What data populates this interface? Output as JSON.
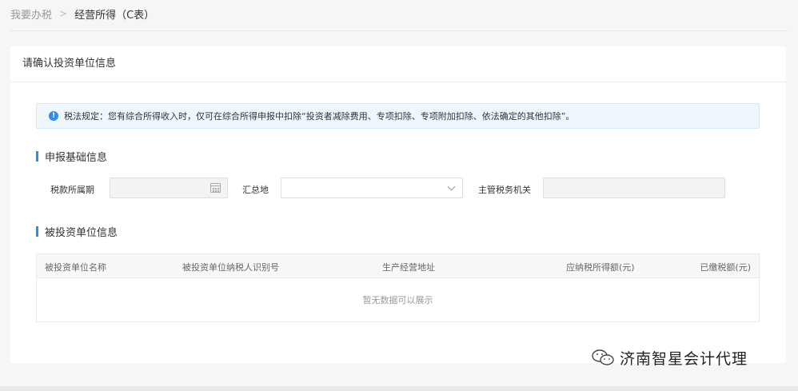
{
  "breadcrumb": {
    "home": "我要办税",
    "separator": ">",
    "current": "经营所得（C表）"
  },
  "card": {
    "title": "请确认投资单位信息"
  },
  "notice": {
    "icon": "info-icon",
    "text": "税法规定：您有综合所得收入时，仅可在综合所得申报中扣除“投资者减除费用、专项扣除、专项附加扣除、依法确定的其他扣除”。"
  },
  "sections": {
    "basic_info": "申报基础信息",
    "investee_info": "被投资单位信息"
  },
  "form": {
    "tax_period_label": "税款所属期",
    "tax_period_value": "",
    "summary_place_label": "汇总地",
    "summary_place_value": "",
    "tax_office_label": "主管税务机关",
    "tax_office_value": ""
  },
  "table": {
    "columns": [
      "被投资单位名称",
      "被投资单位纳税人识别号",
      "生产经营地址",
      "应纳税所得额(元)",
      "已缴税额(元)"
    ],
    "rows": [],
    "empty_text": "暂无数据可以展示"
  },
  "watermark": {
    "text": "济南智星会计代理",
    "icon": "wechat-icon"
  },
  "colors": {
    "accent": "#2d8cf0",
    "notice_bg": "#eef6fe",
    "page_bg": "#f5f6f8"
  }
}
